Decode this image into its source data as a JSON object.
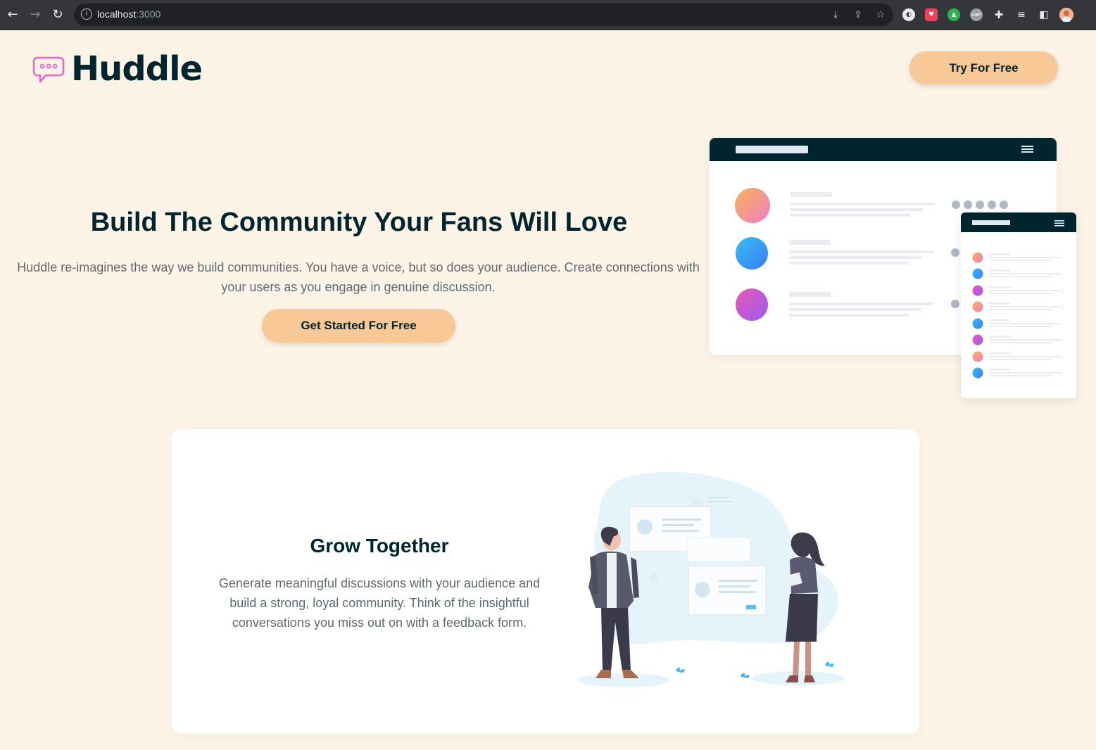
{
  "browser": {
    "url_host": "localhost",
    "url_port": ":3000",
    "icons": [
      "back-icon",
      "forward-icon",
      "reload-icon",
      "site-info-icon",
      "install-icon",
      "share-icon",
      "bookmark-star-icon"
    ],
    "extensions": [
      "extension-dark-mode-icon",
      "extension-pocket-icon",
      "extension-green-icon",
      "extension-abp-icon",
      "extensions-puzzle-icon",
      "reading-list-icon",
      "side-panel-icon",
      "profile-avatar"
    ],
    "abp_label": "ABP"
  },
  "header": {
    "logo_text": "Huddle",
    "try_button": "Try For Free"
  },
  "hero": {
    "title": "Build The Community Your Fans Will Love",
    "description": "Huddle re-imagines the way we build communities. You have a voice, but so does your audience. Create connections with your users as you engage in genuine discussion.",
    "cta": "Get Started For Free"
  },
  "feature": {
    "title": "Grow Together",
    "description": "Generate meaningful discussions with your audience and build a strong, loyal community. Think of the insightful conversations you miss out on with a feedback form."
  },
  "colors": {
    "background": "#fdf3e7",
    "navy": "#00252e",
    "peach": "#f8c896",
    "text_gray": "#5d6b70",
    "logo_pink": "#e667c8"
  }
}
